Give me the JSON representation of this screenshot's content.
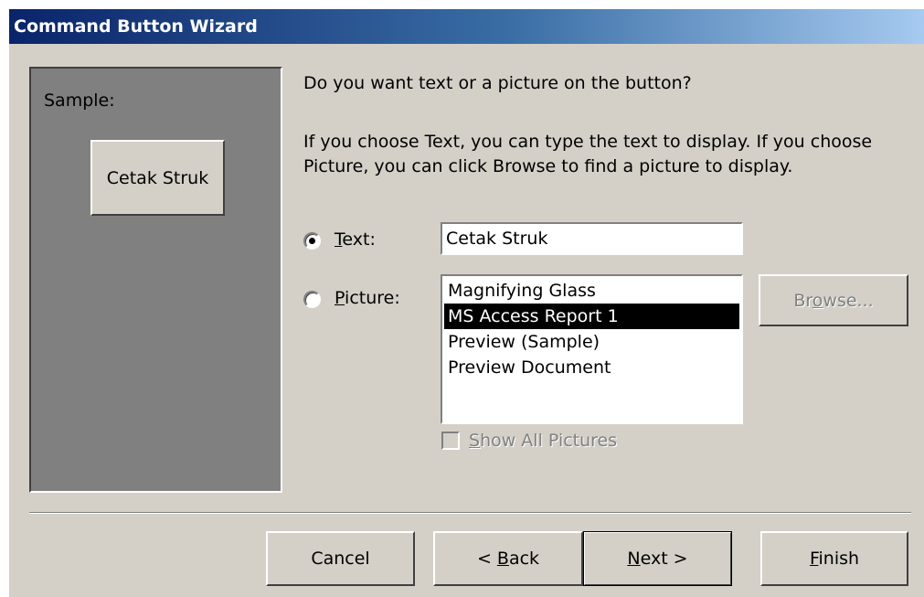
{
  "window": {
    "title": "Command Button Wizard"
  },
  "sample": {
    "label": "Sample:",
    "button_text": "Cetak Struk"
  },
  "question": "Do you want text or a picture on the button?",
  "help_text": "If you choose Text, you can type the text to display.  If you choose Picture, you can click Browse to find a picture to display.",
  "options": {
    "text": {
      "label_prefix": "",
      "label_mnemonic": "T",
      "label_rest": "ext:",
      "selected": true
    },
    "picture": {
      "label_prefix": "",
      "label_mnemonic": "P",
      "label_rest": "icture:",
      "selected": false
    }
  },
  "text_input": {
    "value": "Cetak Struk"
  },
  "picture_list": {
    "items": [
      "Magnifying Glass",
      "MS Access Report 1",
      "Preview (Sample)",
      "Preview Document"
    ],
    "selected_index": 1
  },
  "browse_button": {
    "prefix": "Br",
    "mnemonic": "o",
    "rest": "wse...",
    "enabled": false
  },
  "show_all": {
    "prefix": "",
    "mnemonic": "S",
    "rest": "how All Pictures",
    "checked": false,
    "enabled": false
  },
  "buttons": {
    "cancel": {
      "prefix": "Cancel",
      "mnemonic": "",
      "rest": ""
    },
    "back": {
      "prefix": "< ",
      "mnemonic": "B",
      "rest": "ack"
    },
    "next": {
      "prefix": "",
      "mnemonic": "N",
      "rest": "ext >"
    },
    "finish": {
      "prefix": "",
      "mnemonic": "F",
      "rest": "inish"
    }
  }
}
